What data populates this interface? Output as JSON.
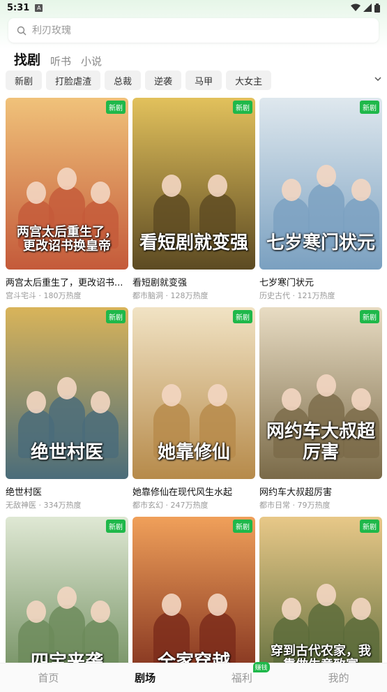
{
  "status": {
    "time": "5:31",
    "notif_icon": "A"
  },
  "search": {
    "placeholder": "利刃玫瑰"
  },
  "tabs": [
    {
      "label": "找剧",
      "active": true
    },
    {
      "label": "听书",
      "active": false
    },
    {
      "label": "小说",
      "active": false
    }
  ],
  "chips": [
    "新剧",
    "打脸虐渣",
    "总裁",
    "逆袭",
    "马甲",
    "大女主"
  ],
  "badge_new": "新剧",
  "cards": [
    {
      "title": "两宫太后重生了，更改诏书...",
      "poster_text": "两宫太后重生了，更改诏书换皇帝",
      "genre": "宫斗宅斗",
      "heat": "180万热度",
      "palette": [
        "#c45a3a",
        "#f0c27a"
      ]
    },
    {
      "title": "看短剧就变强",
      "poster_text": "看短剧就变强",
      "genre": "都市脑洞",
      "heat": "128万热度",
      "palette": [
        "#5c4a22",
        "#e2c15c"
      ]
    },
    {
      "title": "七岁寒门状元",
      "poster_text": "七岁寒门状元",
      "genre": "历史古代",
      "heat": "121万热度",
      "palette": [
        "#7aa0c0",
        "#dfe8ee"
      ]
    },
    {
      "title": "绝世村医",
      "poster_text": "绝世村医",
      "genre": "无敌神医",
      "heat": "334万热度",
      "palette": [
        "#4a6c7a",
        "#d9b45a"
      ]
    },
    {
      "title": "她靠修仙在现代风生水起",
      "poster_text": "她靠修仙",
      "genre": "都市玄幻",
      "heat": "247万热度",
      "palette": [
        "#b68a4a",
        "#f1e3c4"
      ]
    },
    {
      "title": "网约车大叔超厉害",
      "poster_text": "网约车大叔超厉害",
      "genre": "都市日常",
      "heat": "79万热度",
      "palette": [
        "#7a6a48",
        "#e8dcc3"
      ]
    },
    {
      "title": "",
      "poster_text": "四宝来袭",
      "genre": "",
      "heat": "",
      "palette": [
        "#6c8a5a",
        "#dfe8d4"
      ]
    },
    {
      "title": "",
      "poster_text": "全家穿越",
      "genre": "",
      "heat": "",
      "palette": [
        "#7a2a1a",
        "#f0a05a"
      ]
    },
    {
      "title": "",
      "poster_text": "穿到古代农家，我靠做生意致富",
      "genre": "",
      "heat": "",
      "palette": [
        "#5a6a3a",
        "#e8c888"
      ]
    }
  ],
  "nav": [
    {
      "label": "首页",
      "active": false
    },
    {
      "label": "剧场",
      "active": true
    },
    {
      "label": "福利",
      "active": false,
      "badge": "赚钱"
    },
    {
      "label": "我的",
      "active": false
    }
  ],
  "colors": {
    "accent": "#1fb84a",
    "chip_bg": "#f1f1f1"
  }
}
